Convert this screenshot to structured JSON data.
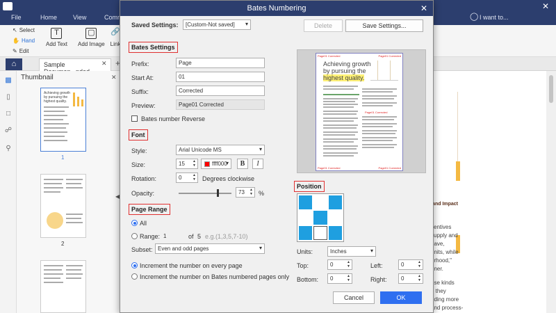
{
  "app": {
    "menu_tabs": [
      "File",
      "Home",
      "View",
      "Comm"
    ],
    "help_placeholder": "I want to...",
    "ribbon": {
      "select": "Select",
      "hand": "Hand",
      "edit": "Edit",
      "add_text": "Add Text",
      "add_image": "Add Image",
      "link": "Link"
    },
    "doc_tab": "Sample Documen...nded",
    "thumbnail_title": "Thumbnail",
    "thumbnails": [
      {
        "page": "1",
        "heading": "Achieving growth by pursuing the highest quality."
      },
      {
        "page": "2"
      }
    ],
    "doc_text_lines": [
      "centives",
      "supply and",
      "have,",
      "units, while",
      "urhood,\"",
      "nner.",
      "",
      "ese kinds",
      "e they",
      "nding more",
      "and process-"
    ],
    "doc_heading": "me and Impact"
  },
  "dialog": {
    "title": "Bates Numbering",
    "saved_settings_label": "Saved Settings:",
    "saved_settings_value": "[Custom-Not saved]",
    "delete_button": "Delete",
    "save_settings_button": "Save Settings...",
    "bates_settings": {
      "header": "Bates Settings",
      "prefix_label": "Prefix:",
      "prefix_value": "Page",
      "start_label": "Start At:",
      "start_value": "01",
      "suffix_label": "Suffix:",
      "suffix_value": "Corrected",
      "preview_label": "Preview:",
      "preview_value": "Page01 Corrected",
      "reverse_label": "Bates number Reverse"
    },
    "font": {
      "header": "Font",
      "style_label": "Style:",
      "style_value": "Arial Unicode MS",
      "size_label": "Size:",
      "size_value": "15",
      "color_value": "ffff000",
      "color_hex": "#ff0000",
      "bold_label": "B",
      "italic_label": "I",
      "rotation_label": "Rotation:",
      "rotation_value": "0",
      "rotation_unit": "Degrees clockwise",
      "opacity_label": "Opacity:",
      "opacity_value": "73",
      "opacity_percent": 73,
      "opacity_unit": "%"
    },
    "page_range": {
      "header": "Page Range",
      "all_label": "All",
      "range_label": "Range:",
      "range_from": "1",
      "range_of": "of",
      "range_total": "5",
      "range_hint": "e.g.(1,3,5,7-10)",
      "subset_label": "Subset:",
      "subset_value": "Even and odd pages",
      "increment_every": "Increment the number on every page",
      "increment_bates": "Increment the number on Bates numbered pages only"
    },
    "preview": {
      "heading": [
        "Achieving growth",
        "by pursuing the",
        "highest quality."
      ],
      "stamp": "Page01 Corrected"
    },
    "position": {
      "header": "Position",
      "grid": [
        true,
        false,
        true,
        false,
        true,
        false,
        true,
        false,
        true
      ],
      "units_label": "Units:",
      "units_value": "Inches",
      "top_label": "Top:",
      "top_value": "0",
      "left_label": "Left:",
      "left_value": "0",
      "bottom_label": "Bottom:",
      "bottom_value": "0",
      "right_label": "Right:",
      "right_value": "0"
    },
    "cancel_button": "Cancel",
    "ok_button": "OK"
  },
  "colors": {
    "titlebar": "#2c3e6e",
    "accent": "#2f6ff0",
    "section_border": "#e03030",
    "grid_on": "#1f9fe0"
  }
}
